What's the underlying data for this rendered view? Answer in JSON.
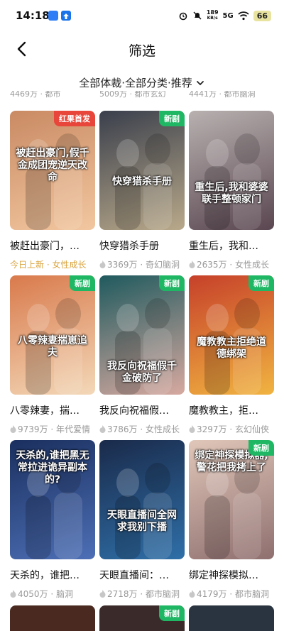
{
  "status_bar": {
    "time": "14:18",
    "speed_value": "189",
    "speed_unit": "KB/s",
    "network": "5G",
    "battery": "66"
  },
  "nav": {
    "title": "筛选"
  },
  "filter": {
    "label": "全部体裁·全部分类·推荐"
  },
  "prev_row": [
    "4469万 · 都市",
    "5009万 · 都市玄幻",
    "4441万 · 都市脑洞"
  ],
  "cards": [
    {
      "title": "被赶出豪门，…",
      "meta": "今日上新 · 女性成长",
      "badge": "红果首发",
      "badge_color": "#e8463a",
      "poster_text": "被赶出豪门,假千金成团宠逆天改命",
      "bg": [
        "#c98a63",
        "#f2c7a0"
      ]
    },
    {
      "title": "快穿猎杀手册",
      "meta": "3369万 · 奇幻脑洞",
      "badge": "新剧",
      "badge_color": "#1fb764",
      "poster_text": "快穿猎杀手册",
      "bg": [
        "#3a3f4c",
        "#b9a98a"
      ]
    },
    {
      "title": "重生后，我和…",
      "meta": "2635万 · 女性成长",
      "badge": "",
      "badge_color": "",
      "poster_text": "重生后,我和婆婆联手整顿家门",
      "bg": [
        "#b8b1b0",
        "#5a4650"
      ]
    },
    {
      "title": "八零辣妻，揣…",
      "meta": "9739万 · 年代爱情",
      "badge": "新剧",
      "badge_color": "#1fb764",
      "poster_text": "八零辣妻揣崽追夫",
      "bg": [
        "#d97a4c",
        "#f3d8b8"
      ]
    },
    {
      "title": "我反向祝福假…",
      "meta": "3786万 · 女性成长",
      "badge": "新剧",
      "badge_color": "#1fb764",
      "poster_text": "我反向祝福假千金破防了",
      "bg": [
        "#1f5a5e",
        "#d7a9a0"
      ]
    },
    {
      "title": "魔教教主，拒…",
      "meta": "3297万 · 玄幻仙侠",
      "badge": "新剧",
      "badge_color": "#1fb764",
      "poster_text": "魔教教主拒绝道德绑架",
      "bg": [
        "#c6402a",
        "#f1b441"
      ]
    },
    {
      "title": "天杀的，谁把…",
      "meta": "4050万 · 脑洞",
      "badge": "",
      "badge_color": "",
      "poster_text": "天杀的,谁把黑无常拉进诡异副本的?",
      "bg": [
        "#1a2f5e",
        "#4d6fb6"
      ]
    },
    {
      "title": "天眼直播间：…",
      "meta": "2718万 · 都市脑洞",
      "badge": "",
      "badge_color": "",
      "poster_text": "天眼直播间全网求我别下播",
      "bg": [
        "#1a2a4a",
        "#2f6fa8"
      ]
    },
    {
      "title": "绑定神探模拟…",
      "meta": "4179万 · 都市脑洞",
      "badge": "新剧",
      "badge_color": "#1fb764",
      "poster_text": "绑定神探模拟器,警花把我拷上了",
      "bg": [
        "#e0c7b9",
        "#8f6f6f"
      ]
    }
  ],
  "partial_row": [
    {
      "badge": "",
      "bg": "#4a2a20"
    },
    {
      "badge": "新剧",
      "bg": "#3a2a2a"
    },
    {
      "badge": "",
      "bg": "#2a3440"
    }
  ]
}
